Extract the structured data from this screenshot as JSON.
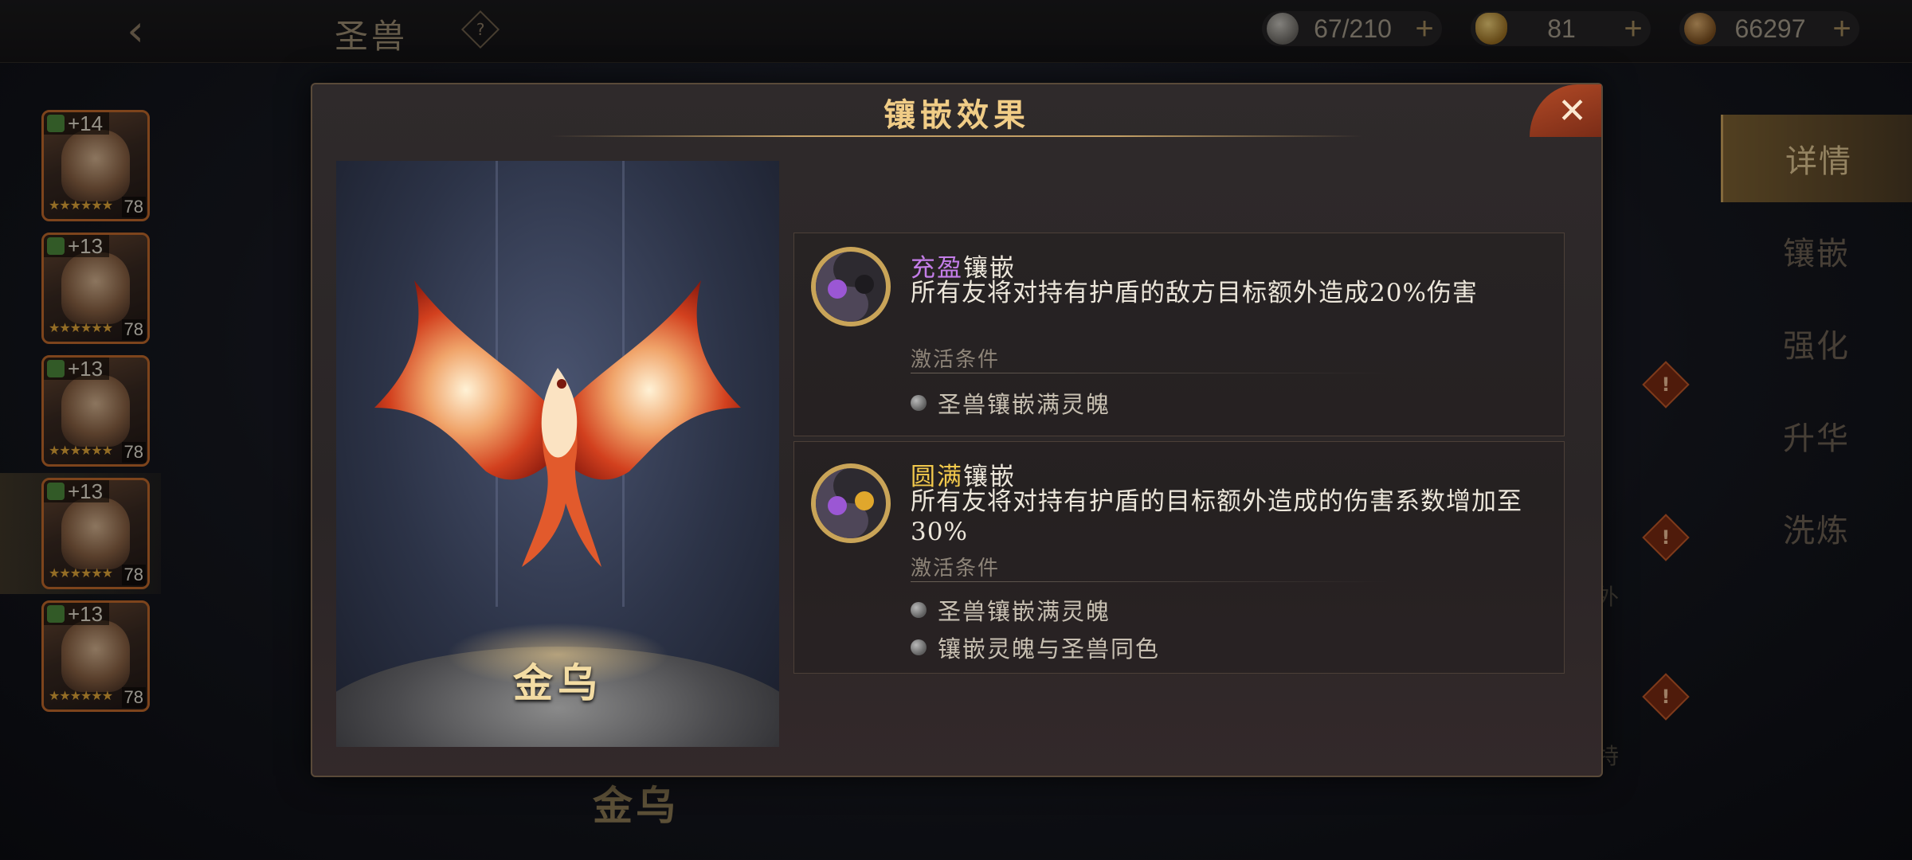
{
  "header": {
    "back_icon": "back-arrow-icon",
    "title": "圣兽",
    "help_icon": "question-diamond-icon",
    "resources": [
      {
        "icon": "stamina-stone-icon",
        "value": "67/210",
        "color": "#8c8a86"
      },
      {
        "icon": "gold-ingot-icon",
        "value": "81",
        "color": "#d6a43e"
      },
      {
        "icon": "copper-coin-icon",
        "value": "66297",
        "color": "#b07a3a"
      }
    ]
  },
  "heroes": [
    {
      "plus": "+14",
      "level": "78",
      "stars": "★★★★★★"
    },
    {
      "plus": "+13",
      "level": "78",
      "stars": "★★★★★★"
    },
    {
      "plus": "+13",
      "level": "78",
      "stars": "★★★★★★"
    },
    {
      "plus": "+13",
      "level": "78",
      "stars": "★★★★★★"
    },
    {
      "plus": "+13",
      "level": "78",
      "stars": "★★★★★★"
    }
  ],
  "tabs": [
    "详情",
    "镶嵌",
    "强化",
    "升华",
    "洗炼"
  ],
  "background": {
    "beast_name": "金乌",
    "text_fragment_1": "外",
    "text_fragment_2": "特"
  },
  "dialog": {
    "title": "镶嵌效果",
    "close_icon": "close-x-icon",
    "beast_name": "金乌",
    "effects": [
      {
        "title_highlight": "充盈",
        "title_rest": "镶嵌",
        "highlight_color": "#c47de8",
        "description": "所有友将对持有护盾的敌方目标额外造成20%伤害",
        "condition_label": "激活条件",
        "conditions": [
          "圣兽镶嵌满灵魄"
        ]
      },
      {
        "title_highlight": "圆满",
        "title_rest": "镶嵌",
        "highlight_color": "#f2c94c",
        "description": "所有友将对持有护盾的目标额外造成的伤害系数增加至30%",
        "condition_label": "激活条件",
        "conditions": [
          "圣兽镶嵌满灵魄",
          "镶嵌灵魄与圣兽同色"
        ]
      }
    ]
  }
}
